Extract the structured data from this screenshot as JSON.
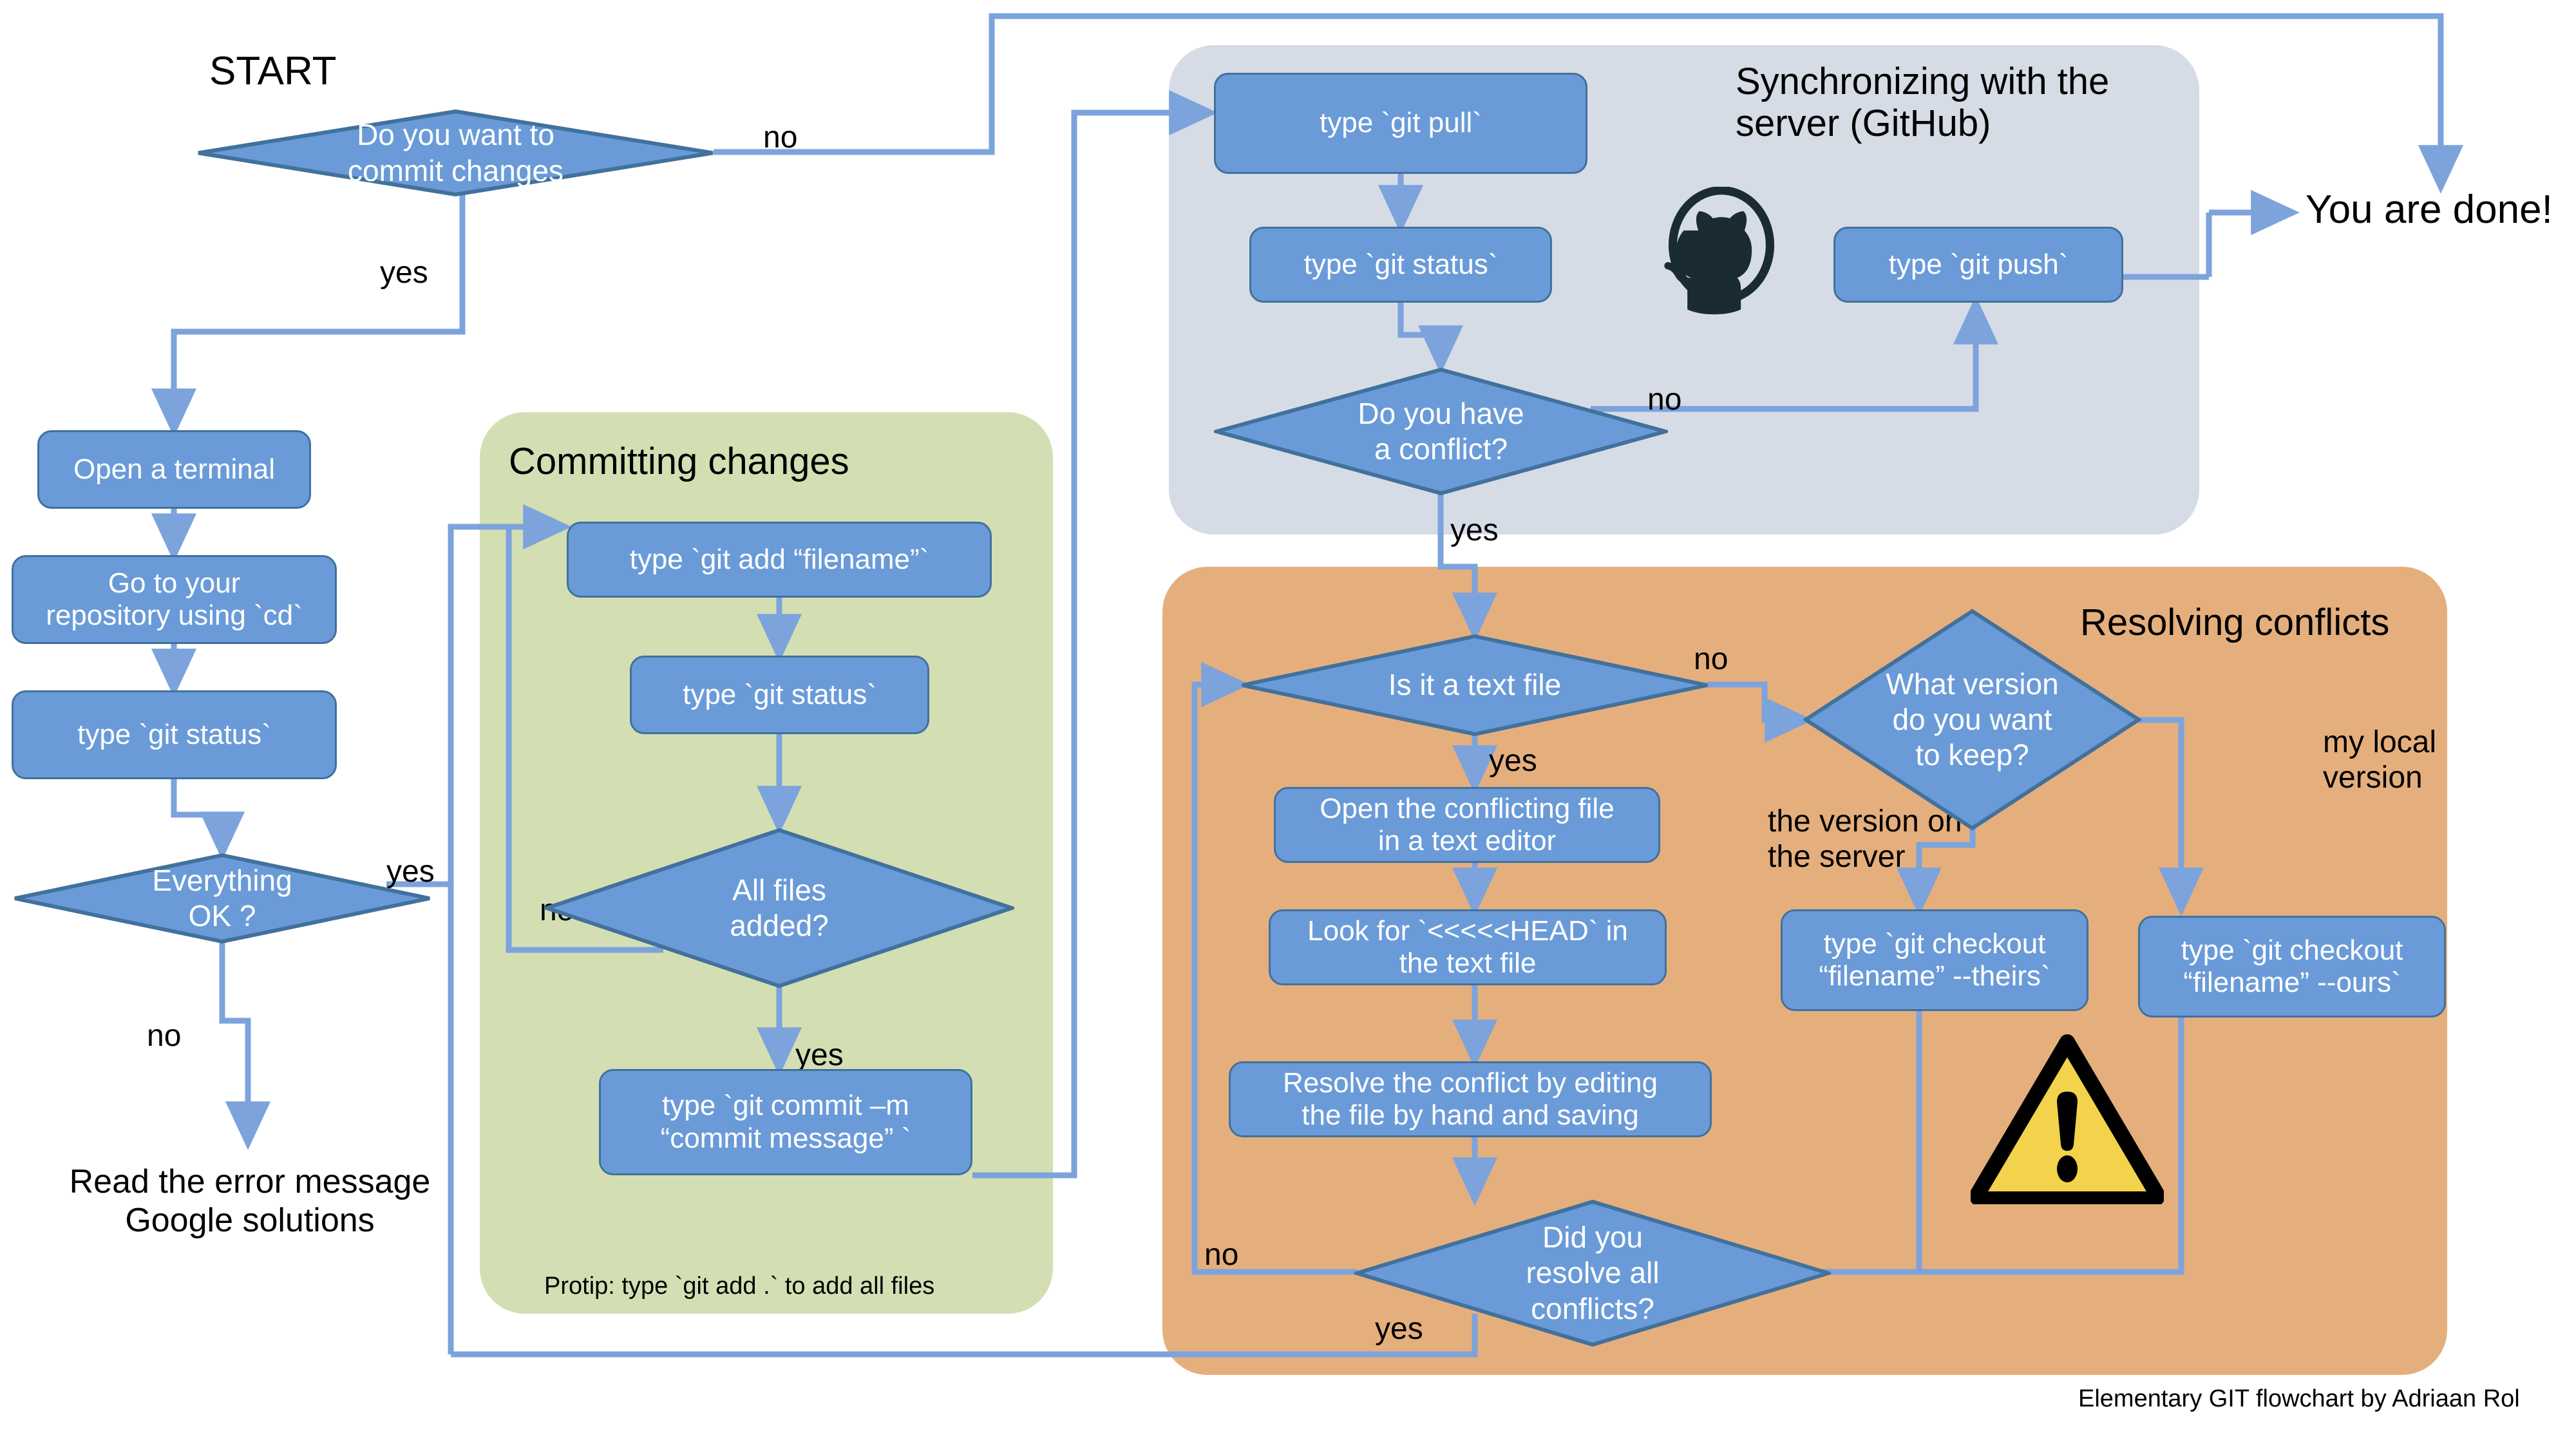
{
  "title_text": "Elementary GIT flowchart by Adriaan Rol",
  "start_label": "START",
  "done_label": "You are done!",
  "error_text_line1": "Read the error message",
  "error_text_line2": "Google solutions",
  "colors": {
    "node_fill": "#6A9BD8",
    "node_border": "#41719C",
    "connector": "#7CA3DC",
    "panel_commit": "#D3DFB3",
    "panel_sync": "#D6DCE5",
    "panel_conflict": "#E5AF7D",
    "warning_fill": "#F2D34B",
    "warning_stroke": "#000000",
    "github_icon": "#1B2B34",
    "text_on_node": "#FFFFFF",
    "text_plain": "#000000"
  },
  "panels": [
    {
      "name": "committing-changes",
      "title": "Committing changes"
    },
    {
      "name": "synchronizing",
      "title_line1": "Synchronizing with the",
      "title_line2": "server (GitHub)"
    },
    {
      "name": "resolving-conflicts",
      "title": "Resolving conflicts"
    }
  ],
  "protip": "Protip: type `git add .` to add all files",
  "nodes": {
    "open_terminal": "Open a terminal",
    "go_to_repo_l1": "Go to your",
    "go_to_repo_l2": "repository using `cd`",
    "git_status_left": "type `git status`",
    "git_add": "type `git add “filename”`",
    "git_status_commit": "type `git status`",
    "git_commit_l1": "type `git commit –m",
    "git_commit_l2": "“commit message” `",
    "git_pull": "type `git pull`",
    "git_status_sync": "type `git status`",
    "git_push": "type `git push`",
    "open_conflicting_l1": "Open the conflicting file",
    "open_conflicting_l2": "in a text editor",
    "look_for_head_l1": "Look for `<<<<<HEAD` in",
    "look_for_head_l2": "the text file",
    "resolve_edit_l1": "Resolve the conflict by editing",
    "resolve_edit_l2": "the file by hand and saving",
    "checkout_theirs_l1": "type `git checkout",
    "checkout_theirs_l2": "“filename” --theirs`",
    "checkout_ours_l1": "type `git checkout",
    "checkout_ours_l2": "“filename” --ours`"
  },
  "decisions": {
    "commit_changes_l1": "Do you want to",
    "commit_changes_l2": "commit changes",
    "everything_ok_l1": "Everything",
    "everything_ok_l2": "OK ?",
    "all_files_added_l1": "All files",
    "all_files_added_l2": "added?",
    "have_conflict_l1": "Do you have",
    "have_conflict_l2": "a conflict?",
    "is_text_file": "Is it a text file",
    "what_version_l1": "What version",
    "what_version_l2": "do you want",
    "what_version_l3": "to keep?",
    "resolved_all_l1": "Did you",
    "resolved_all_l2": "resolve all",
    "resolved_all_l3": "conflicts?"
  },
  "edge_labels": {
    "start_no": "no",
    "start_yes": "yes",
    "ok_yes": "yes",
    "ok_no": "no",
    "added_no": "no",
    "added_yes": "yes",
    "conflict_no": "no",
    "conflict_yes": "yes",
    "text_no": "no",
    "text_yes": "yes",
    "version_server_l1": "the version on",
    "version_server_l2": "the server",
    "version_local_l1": "my local",
    "version_local_l2": "version",
    "resolved_no": "no",
    "resolved_yes": "yes"
  },
  "icons": {
    "github": "github-octocat-icon",
    "warning": "warning-triangle-icon"
  }
}
